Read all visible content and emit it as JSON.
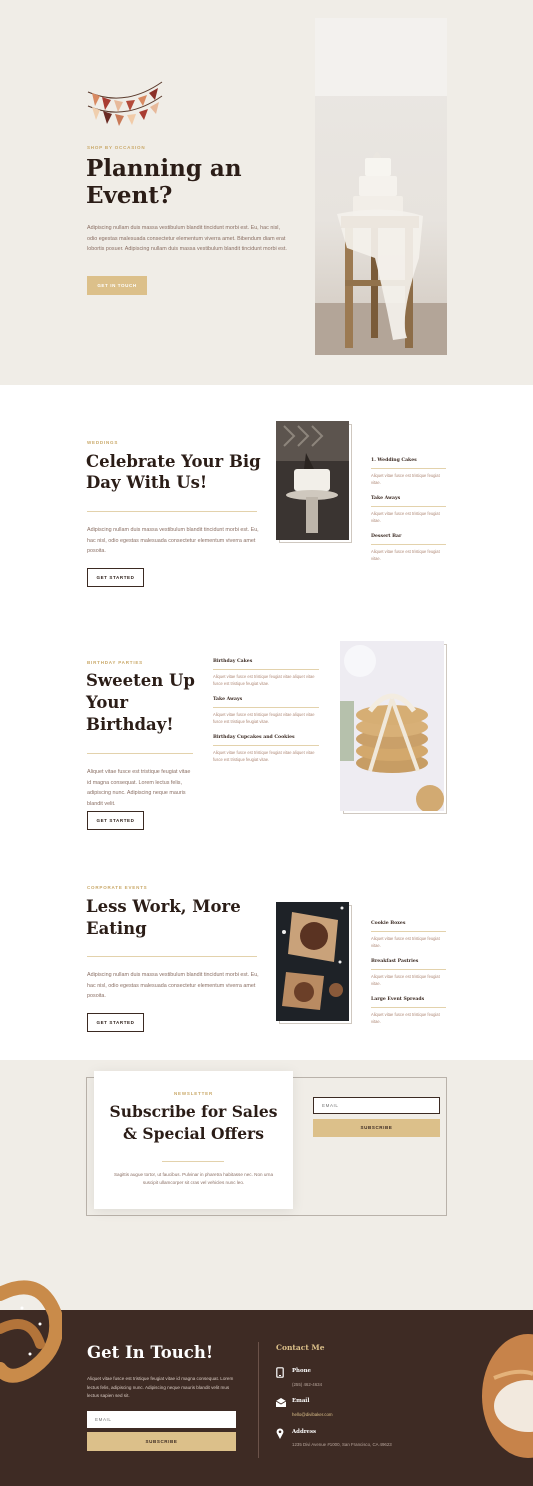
{
  "hero": {
    "eyebrow": "SHOP BY OCCASION",
    "title_line1": "Planning an",
    "title_line2": "Event?",
    "text": "Adipiscing nullam duis massa vestibulum blandit tincidunt morbi est. Eu, hac nisl, odio egestas malesuada consectetur elementum viverra amet. Bibendum diam erat lobortis posuer. Adipiscing nullam duis massa vestibulum blandit tincidunt morbi est.",
    "button": "GET IN TOUCH"
  },
  "weddings": {
    "eyebrow": "WEDDINGS",
    "title_line1": "Celebrate Your Big",
    "title_line2": "Day With Us!",
    "text": "Adipiscing nullam duis massa vestibulum blandit tincidunt morbi est. Eu, hac nisl, odio egestas malesuada consectetur elementum viverra amet posoita.",
    "button": "GET STARTED",
    "items": [
      {
        "title": "1. Wedding Cakes",
        "desc": "Aliquet vitae fusce est tristique feugiat vitae."
      },
      {
        "title": "Take Aways",
        "desc": "Aliquet vitae fusce est tristique feugiat vitae."
      },
      {
        "title": "Dessert Bar",
        "desc": "Aliquet vitae fusce est tristique feugiat vitae."
      }
    ]
  },
  "birthday": {
    "eyebrow": "BIRTHDAY PARTIES",
    "title_line1": "Sweeten Up",
    "title_line2": "Your",
    "title_line3": "Birthday!",
    "text": "Aliquet vitae fusce est tristique feugiat vitae id magna consequat. Lorem lectus felis, adipiscing nunc. Adipiscing neque mauris blandit velit.",
    "button": "GET STARTED",
    "items": [
      {
        "title": "Birthday Cakes",
        "desc": "Aliquet vitae fusce est tristique feugiat vitae aliquet vitae fusce est tristique feugiat vitae."
      },
      {
        "title": "Take Aways",
        "desc": "Aliquet vitae fusce est tristique feugiat vitae aliquet vitae fusce est tristique feugiat vitae."
      },
      {
        "title": "Birthday Cupcakes and Cookies",
        "desc": "Aliquet vitae fusce est tristique feugiat vitae aliquet vitae fusce est tristique feugiat vitae."
      }
    ]
  },
  "corporate": {
    "eyebrow": "CORPORATE EVENTS",
    "title_line1": "Less Work, More",
    "title_line2": "Eating",
    "text": "Adipiscing nullam duis massa vestibulum blandit tincidunt morbi est. Eu, hac nisl, odio egestas malesuada consectetur elementum viverra amet posoita.",
    "button": "GET STARTED",
    "items": [
      {
        "title": "Cookie Boxes",
        "desc": "Aliquet vitae fusce est tristique feugiat vitae."
      },
      {
        "title": "Breakfast Pastries",
        "desc": "Aliquet vitae fusce est tristique feugiat vitae."
      },
      {
        "title": "Large Event Spreads",
        "desc": "Aliquet vitae fusce est tristique feugiat vitae."
      }
    ]
  },
  "newsletter": {
    "eyebrow": "NEWSLETTER",
    "title_line1": "Subscribe for Sales",
    "title_line2": "& Special Offers",
    "text": "Sagittis augue tortor, ut faucibus. Pulvinar in pharetra habitasse nec. Non urna suscipit ullamcorper sit cras vel vehicles nunc leo.",
    "email_placeholder": "EMAIL",
    "button": "SUBSCRIBE"
  },
  "footer": {
    "title": "Get In Touch!",
    "text": "Aliquet vitae fusce est tristique feugiat vitae id magna consequat. Lorem lectus felis, adipiscing nunc. Adipiscing neque mauris blandit velit mus lectus sapien sed sit.",
    "email_placeholder": "EMAIL",
    "button": "SUBSCRIBE",
    "contact_heading": "Contact Me",
    "phone_label": "Phone",
    "phone_value": "(255) 462-4634",
    "email_label": "Email",
    "email_value": "hello@divibaker.com",
    "address_label": "Address",
    "address_value": "1235 Divi Avenue #1000, San Francisco, CA 49623"
  },
  "colors": {
    "accent": "#d9bc7a",
    "dark_brown": "#3e2b24",
    "paper": "#f2efea"
  }
}
